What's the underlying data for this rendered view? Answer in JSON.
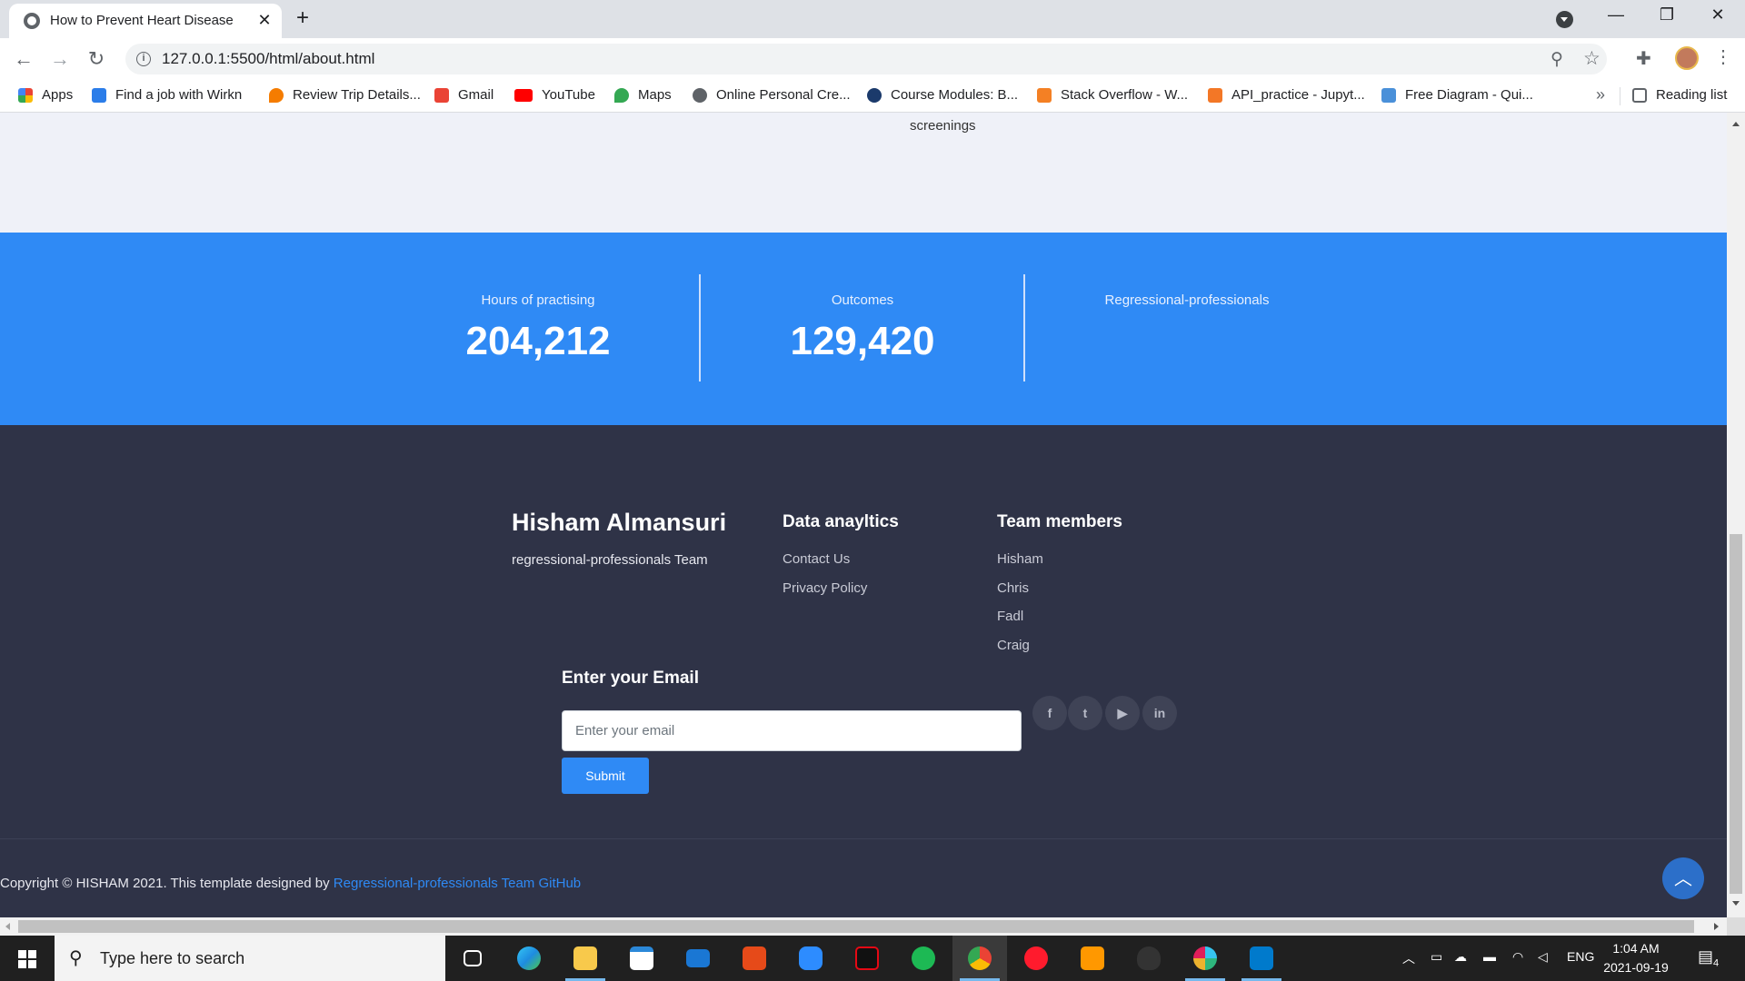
{
  "browser": {
    "tab_title": "How to Prevent Heart Disease",
    "url": "127.0.0.1:5500/html/about.html",
    "bookmarks": [
      {
        "label": "Apps",
        "color": "#4285f4"
      },
      {
        "label": "Find a job with Wirkn",
        "color": "#2b7de9"
      },
      {
        "label": "Review Trip Details...",
        "color": "#f57c00"
      },
      {
        "label": "Gmail",
        "color": "#ea4335"
      },
      {
        "label": "YouTube",
        "color": "#ff0000"
      },
      {
        "label": "Maps",
        "color": "#34a853"
      },
      {
        "label": "Online Personal Cre...",
        "color": "#5f6368"
      },
      {
        "label": "Course Modules: B...",
        "color": "#1b3a6b"
      },
      {
        "label": "Stack Overflow - W...",
        "color": "#f48024"
      },
      {
        "label": "API_practice - Jupyt...",
        "color": "#f37726"
      },
      {
        "label": "Free Diagram - Qui...",
        "color": "#4a90d9"
      }
    ],
    "reading_list": "Reading list"
  },
  "page": {
    "prev_section_text": "screenings",
    "stats": [
      {
        "label": "Hours of practising",
        "value": "204,212"
      },
      {
        "label": "Outcomes",
        "value": "129,420"
      },
      {
        "label": "Regressional-professionals",
        "value": ""
      }
    ],
    "footer": {
      "brand_title": "Hisham Almansuri",
      "brand_sub": "regressional-professionals Team",
      "col1_title": "Data anayltics",
      "col1_links": [
        "Contact Us",
        "Privacy Policy"
      ],
      "col2_title": "Team members",
      "col2_links": [
        "Hisham",
        "Chris",
        "Fadl",
        "Craig"
      ],
      "email_title": "Enter your Email",
      "email_placeholder": "Enter your email",
      "submit_label": "Submit",
      "social_icons": [
        "facebook-icon",
        "twitter-icon",
        "youtube-icon",
        "linkedin-icon"
      ],
      "copyright_text": "Copyright © HISHAM 2021. This template designed by ",
      "copyright_link": "Regressional-professionals Team GitHub"
    },
    "accent_color": "#2f8af5",
    "footer_bg": "#2f3347"
  },
  "taskbar": {
    "search_placeholder": "Type here to search",
    "lang": "ENG",
    "time": "1:04 AM",
    "date": "2021-09-19",
    "notifications": "4"
  }
}
